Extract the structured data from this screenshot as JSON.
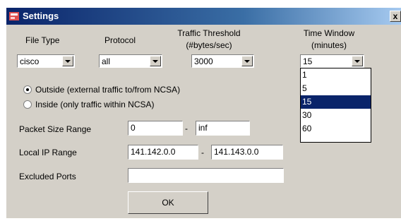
{
  "window": {
    "title": "Settings",
    "close_glyph": "x"
  },
  "file_type": {
    "label": "File Type",
    "value": "cisco"
  },
  "protocol": {
    "label": "Protocol",
    "value": "all"
  },
  "traffic_threshold": {
    "label_line1": "Traffic Threshold",
    "label_line2": "(#bytes/sec)",
    "value": "3000"
  },
  "time_window": {
    "label_line1": "Time Window",
    "label_line2": "(minutes)",
    "value": "15",
    "options": [
      "1",
      "5",
      "15",
      "30",
      "60"
    ],
    "selected_option": "15"
  },
  "scope": {
    "outside_label": "Outside (external traffic to/from NCSA)",
    "inside_label": "Inside (only traffic within NCSA)",
    "selected": "outside"
  },
  "packet_size": {
    "label": "Packet Size Range",
    "min": "0",
    "dash": "-",
    "max": "inf"
  },
  "local_ip": {
    "label": "Local IP Range",
    "start": "141.142.0.0",
    "dash": "-",
    "end": "141.143.0.0"
  },
  "excluded_ports": {
    "label": "Excluded Ports",
    "value": ""
  },
  "ok_label": "OK",
  "colors": {
    "title_bar": "#0a246a",
    "dialog_bg": "#d4d0c8",
    "selection": "#0a246a"
  }
}
